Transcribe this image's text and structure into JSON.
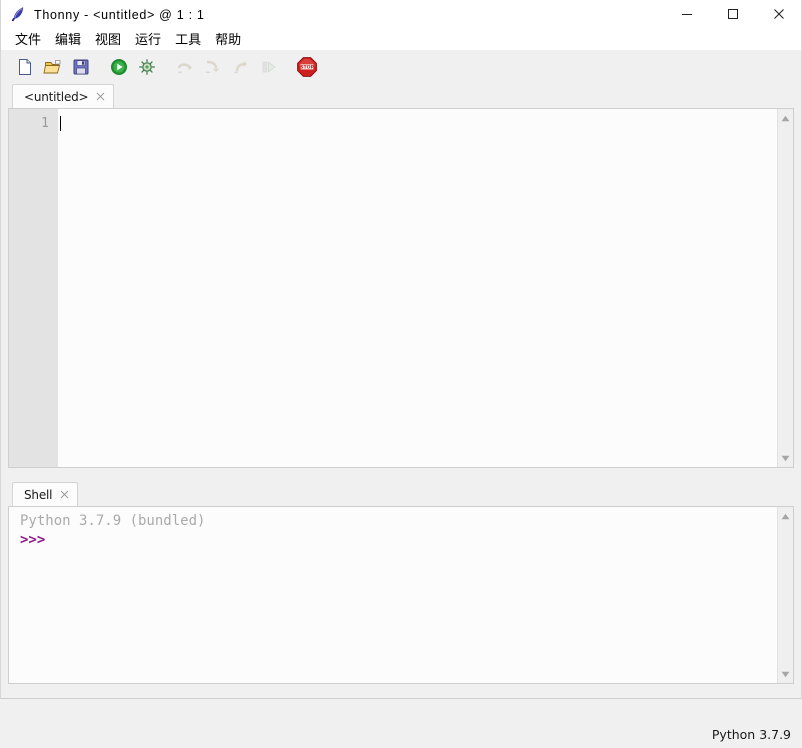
{
  "window": {
    "title": "Thonny  -  <untitled>  @  1 : 1",
    "app_icon": "feather-quill-icon",
    "controls": {
      "minimize": "minimize-icon",
      "maximize": "maximize-icon",
      "close": "close-icon"
    }
  },
  "menubar": {
    "items": [
      {
        "label": "文件"
      },
      {
        "label": "编辑"
      },
      {
        "label": "视图"
      },
      {
        "label": "运行"
      },
      {
        "label": "工具"
      },
      {
        "label": "帮助"
      }
    ]
  },
  "toolbar": {
    "buttons": [
      {
        "name": "new-file-icon",
        "enabled": true
      },
      {
        "name": "open-file-icon",
        "enabled": true
      },
      {
        "name": "save-file-icon",
        "enabled": true
      },
      {
        "name": "run-icon",
        "enabled": true
      },
      {
        "name": "debug-icon",
        "enabled": true
      },
      {
        "name": "step-over-icon",
        "enabled": false
      },
      {
        "name": "step-into-icon",
        "enabled": false
      },
      {
        "name": "step-out-icon",
        "enabled": false
      },
      {
        "name": "resume-icon",
        "enabled": false
      },
      {
        "name": "stop-icon",
        "enabled": true
      }
    ]
  },
  "editor": {
    "tab": {
      "label": "<untitled>",
      "close_icon": "close-icon"
    },
    "line_numbers": [
      "1"
    ],
    "content": "",
    "scrollbar": {
      "up_arrow": "triangle-up-icon",
      "down_arrow": "triangle-down-icon"
    }
  },
  "shell": {
    "tab": {
      "label": "Shell",
      "close_icon": "close-icon"
    },
    "banner": "Python 3.7.9 (bundled)",
    "prompt": ">>>",
    "scrollbar": {
      "up_arrow": "triangle-up-icon",
      "down_arrow": "triangle-down-icon"
    }
  },
  "statusbar": {
    "interpreter": "Python 3.7.9"
  },
  "colors": {
    "chrome": "#f0f0f0",
    "text_bg": "#fcfcfc",
    "gutter_bg": "#e3e3e3",
    "banner_fg": "#aaaaaa",
    "prompt_fg": "#8b1a8b",
    "accent_run": "#1a9b2e",
    "accent_stop": "#cc2222"
  }
}
